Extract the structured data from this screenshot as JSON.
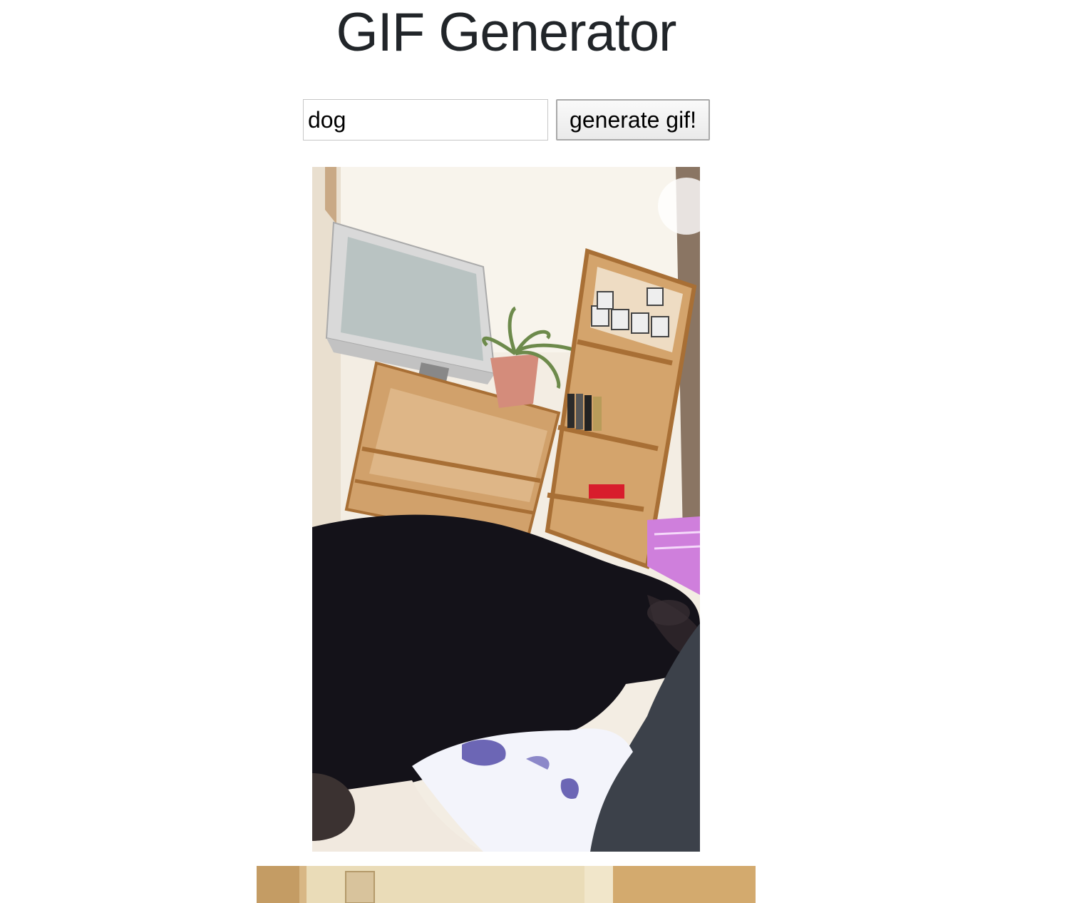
{
  "header": {
    "title": "GIF Generator"
  },
  "search": {
    "value": "dog",
    "button_label": "generate gif!"
  },
  "results": {
    "gifs": [
      {
        "subject": "black dog on bed next to TV and wooden shelves"
      },
      {
        "subject": "room with beige walls (cut off at bottom)"
      }
    ]
  },
  "colors": {
    "title_text": "#212529",
    "input_border": "#c7c7c7",
    "button_border": "#a9a9a9"
  }
}
